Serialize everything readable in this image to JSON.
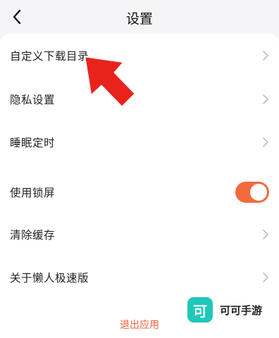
{
  "header": {
    "title": "设置"
  },
  "settings": {
    "items": [
      {
        "label": "自定义下载目录",
        "control": "chevron"
      },
      {
        "label": "隐私设置",
        "control": "chevron"
      },
      {
        "label": "睡眠定时",
        "control": "chevron"
      },
      {
        "label": "使用锁屏",
        "control": "toggle",
        "value": true
      },
      {
        "label": "清除缓存",
        "control": "chevron"
      },
      {
        "label": "关于懒人极速版",
        "control": "chevron"
      }
    ]
  },
  "exit_label": "退出应用",
  "watermark": {
    "logo_char": "可",
    "text": "可可手游"
  },
  "colors": {
    "accent": "#f26b3c",
    "exit": "#f2623a",
    "arrow": "#e8231c",
    "watermark_logo": "#1fc8b8"
  },
  "icons": {
    "back": "chevron-left-icon",
    "row": "chevron-right-icon",
    "annotation": "red-arrow-icon"
  }
}
